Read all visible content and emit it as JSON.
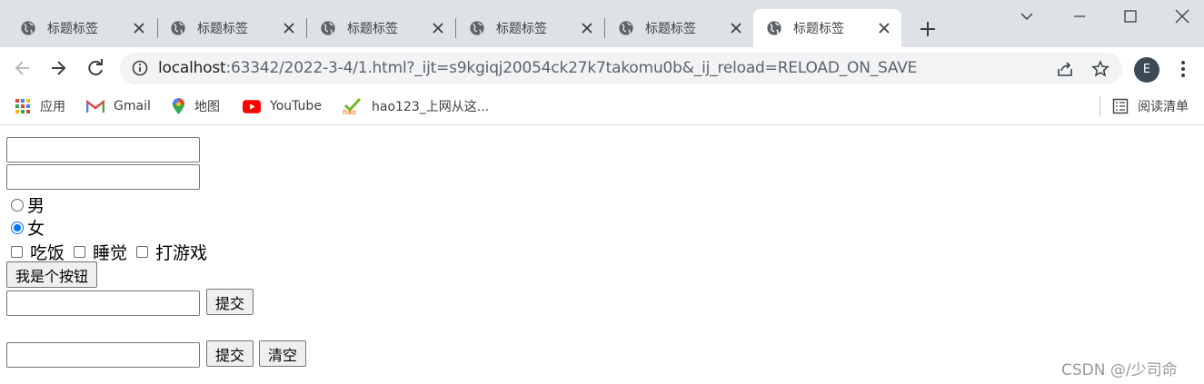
{
  "browser": {
    "tabs": [
      {
        "title": "标题标签"
      },
      {
        "title": "标题标签"
      },
      {
        "title": "标题标签"
      },
      {
        "title": "标题标签"
      },
      {
        "title": "标题标签"
      },
      {
        "title": "标题标签"
      }
    ],
    "address": {
      "host": "localhost",
      "rest": ":63342/2022-3-4/1.html?_ijt=s9kgiqj20054ck27k7takomu0b&_ij_reload=RELOAD_ON_SAVE"
    },
    "profile_initial": "E",
    "bookmarks": [
      {
        "label": "应用",
        "icon": "apps-grid-icon"
      },
      {
        "label": "Gmail",
        "icon": "gmail-icon"
      },
      {
        "label": "地图",
        "icon": "maps-pin-icon"
      },
      {
        "label": "YouTube",
        "icon": "youtube-icon"
      },
      {
        "label": "hao123_上网从这...",
        "icon": "hao123-icon"
      }
    ],
    "reading_list_label": "阅读清单"
  },
  "page": {
    "inputs": [
      {
        "value": ""
      },
      {
        "value": ""
      }
    ],
    "gender": {
      "options": [
        "男",
        "女"
      ],
      "selected": "女"
    },
    "hobbies": [
      {
        "label": "吃饭",
        "checked": false
      },
      {
        "label": "睡觉",
        "checked": false
      },
      {
        "label": "打游戏",
        "checked": false
      }
    ],
    "plain_button_label": "我是个按钮",
    "form1": {
      "input_value": "",
      "submit_label": "提交"
    },
    "form2": {
      "input_value": "",
      "submit_label": "提交",
      "reset_label": "清空"
    }
  },
  "watermark": "CSDN @/少司命",
  "colors": {
    "tabstrip": "#dee1e6",
    "radio_accent": "#0075ff",
    "avatar": "#3c4a55"
  }
}
